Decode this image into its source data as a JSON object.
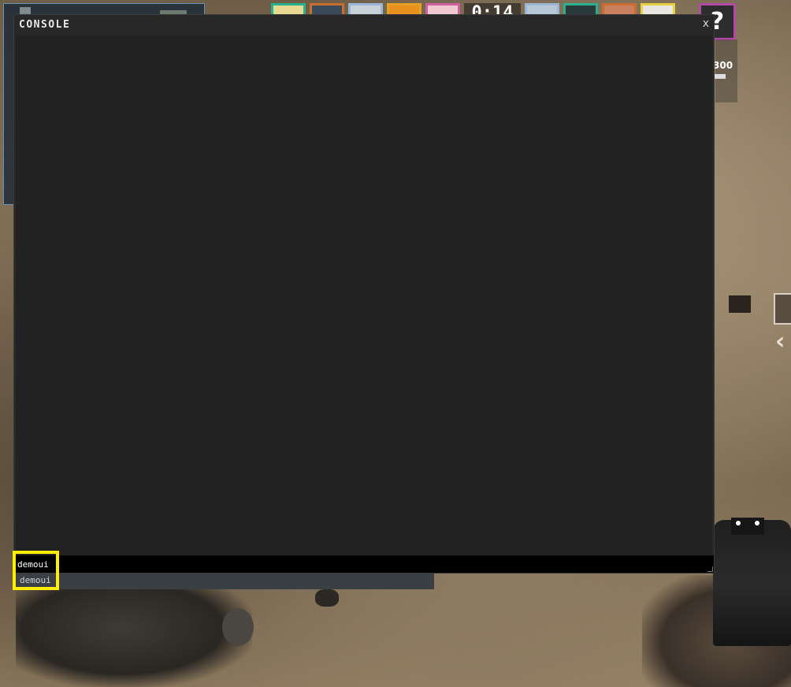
{
  "console": {
    "title": "CONSOLE",
    "close_label": "x",
    "input_value": "demoui",
    "autocomplete": [
      "demoui"
    ]
  },
  "hud": {
    "round_timer": "0:14",
    "help_symbol": "?",
    "money": "300",
    "avatars": [
      {
        "border": "#2bb08e"
      },
      {
        "border": "#c86e2e"
      },
      {
        "border": "#9ab8d4"
      },
      {
        "border": "#e8a020"
      },
      {
        "border": "#d060a0"
      },
      {
        "border": "#9ab8d4"
      },
      {
        "border": "#2bb08e"
      },
      {
        "border": "#c86e2e"
      },
      {
        "border": "#e8d040"
      }
    ]
  },
  "colors": {
    "highlight": "#ffee00",
    "console_bg": "#282828",
    "input_bg": "#000000"
  }
}
